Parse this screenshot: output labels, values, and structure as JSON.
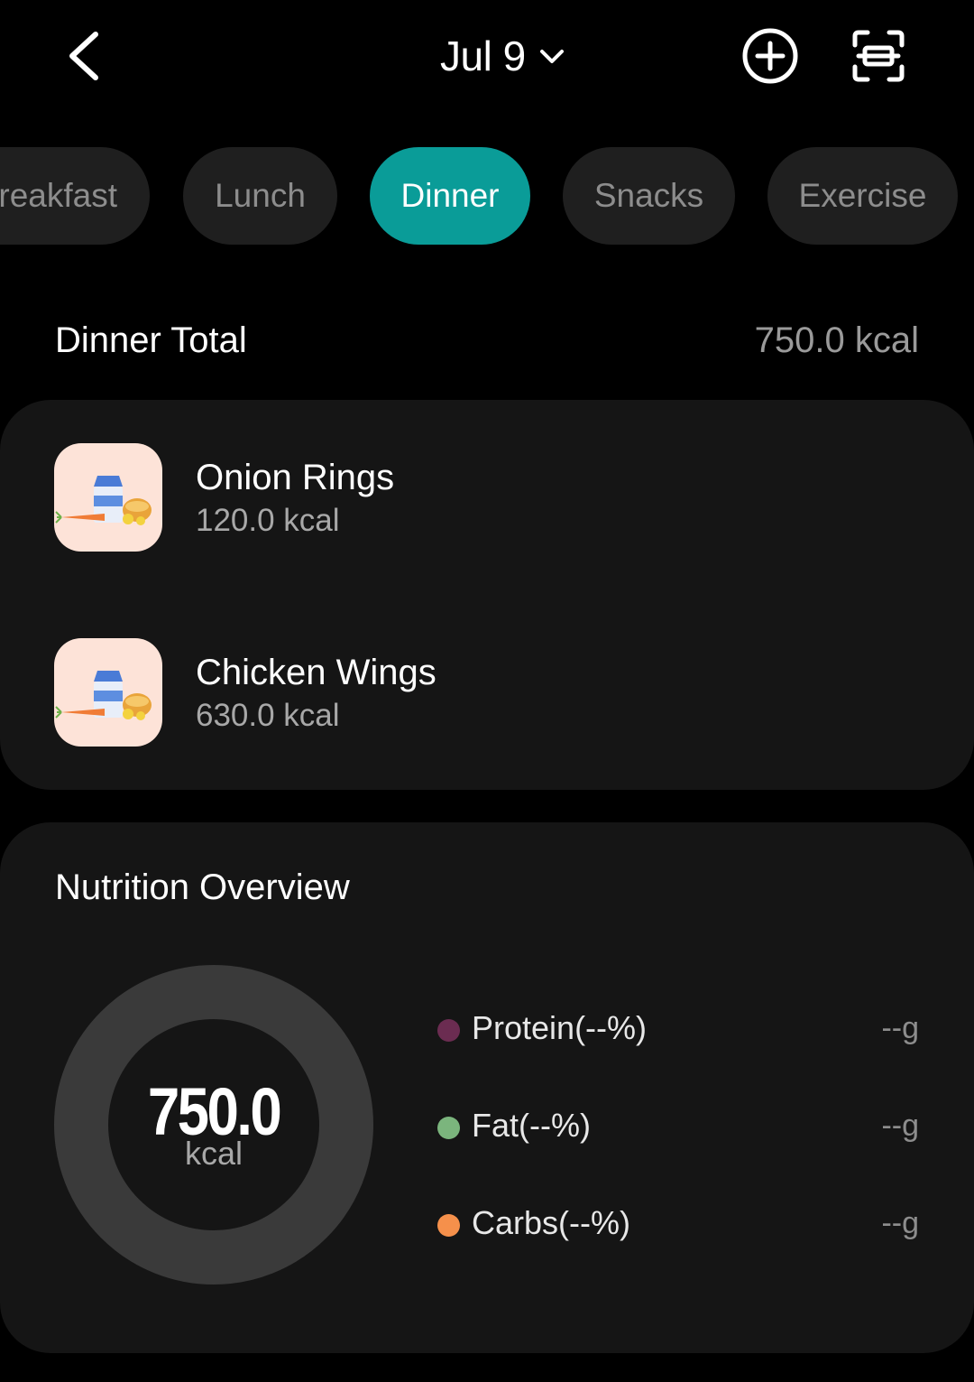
{
  "header": {
    "date": "Jul 9",
    "back_icon": "chevron-left-icon",
    "add_icon": "plus-circle-icon",
    "scan_icon": "scan-icon"
  },
  "tabs": [
    {
      "label": "Breakfast",
      "active": false
    },
    {
      "label": "Lunch",
      "active": false
    },
    {
      "label": "Dinner",
      "active": true
    },
    {
      "label": "Snacks",
      "active": false
    },
    {
      "label": "Exercise",
      "active": false
    }
  ],
  "meal": {
    "title": "Dinner Total",
    "total": "750.0 kcal",
    "items": [
      {
        "name": "Onion Rings",
        "kcal": "120.0 kcal"
      },
      {
        "name": "Chicken Wings",
        "kcal": "630.0 kcal"
      }
    ]
  },
  "nutrition": {
    "title": "Nutrition Overview",
    "total_value": "750.0",
    "total_unit": "kcal",
    "macros": [
      {
        "label": "Protein(--%)",
        "value": "--g",
        "color": "#6b2c51"
      },
      {
        "label": "Fat(--%)",
        "value": "--g",
        "color": "#7bb57d"
      },
      {
        "label": "Carbs(--%)",
        "value": "--g",
        "color": "#f5904b"
      }
    ]
  },
  "colors": {
    "accent": "#0a9c98",
    "card": "#151515",
    "tab_bg": "#1f1f1f",
    "donut_ring": "#3a3a3a"
  }
}
